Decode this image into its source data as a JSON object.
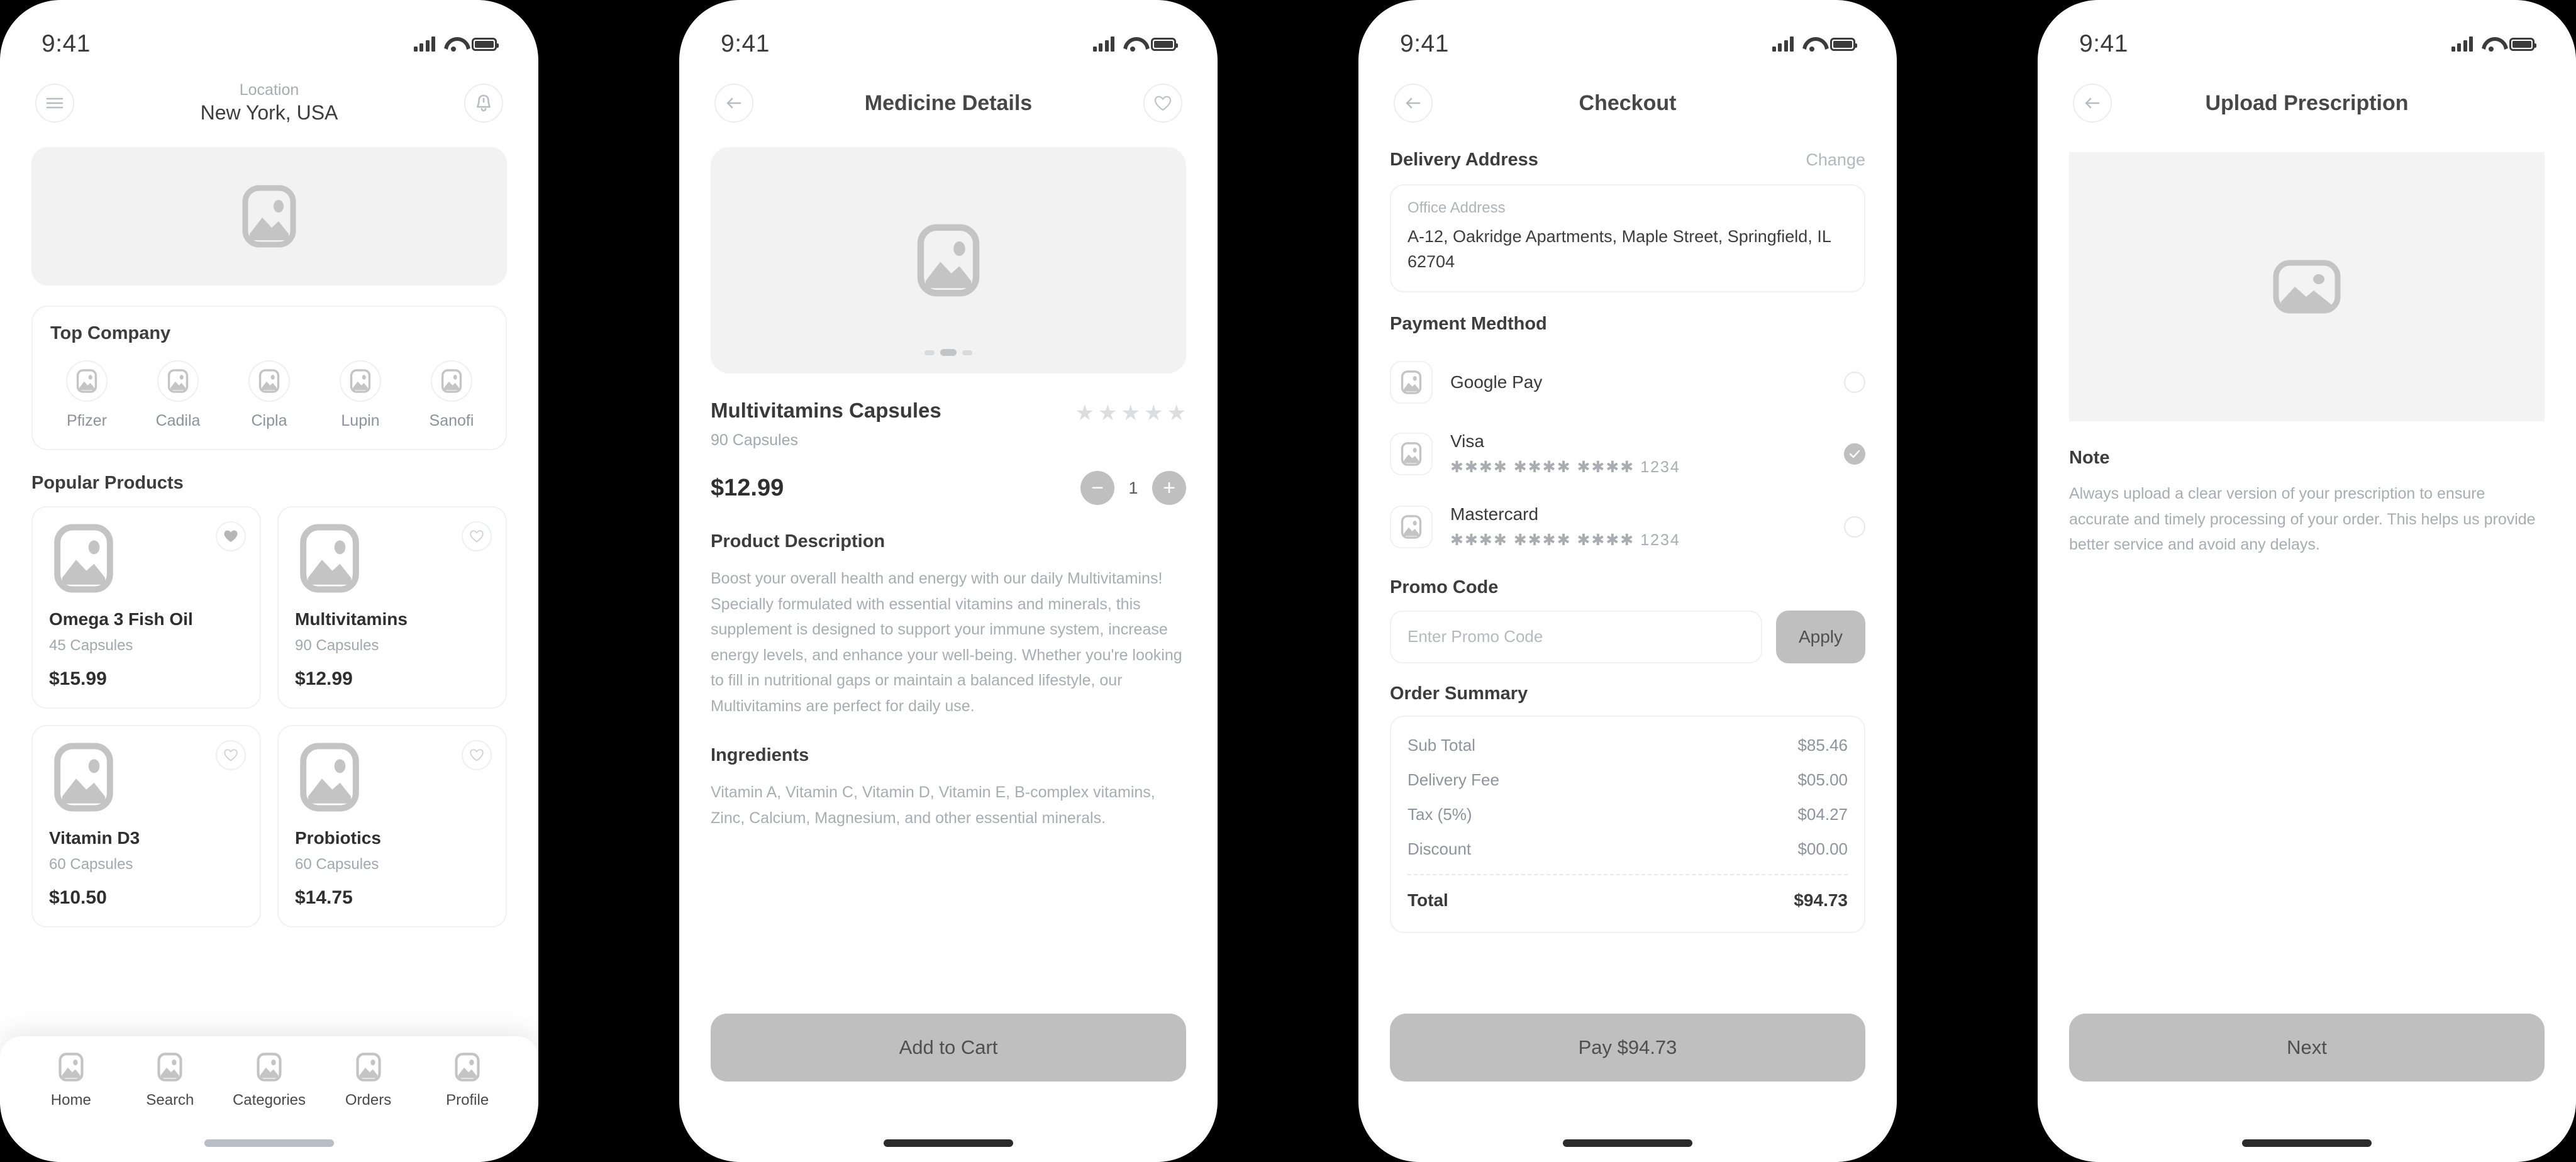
{
  "status_bar": {
    "time": "9:41",
    "signal_icon": "cellular-signal-icon",
    "wifi_icon": "wifi-icon",
    "battery_icon": "battery-icon"
  },
  "screen_home": {
    "menu_icon": "hamburger-menu-icon",
    "bell_icon": "notification-bell-icon",
    "location_label": "Location",
    "location_value": "New York, USA",
    "hero_image": "banner-image-placeholder",
    "top_company": {
      "title": "Top Company",
      "brands": [
        {
          "label": "Pfizer"
        },
        {
          "label": "Cadila"
        },
        {
          "label": "Cipla"
        },
        {
          "label": "Lupin"
        },
        {
          "label": "Sanofi"
        }
      ]
    },
    "popular": {
      "title": "Popular Products",
      "products": [
        {
          "name": "Omega 3 Fish Oil",
          "qty": "45 Capsules",
          "price": "$15.99",
          "favorited": true
        },
        {
          "name": "Multivitamins",
          "qty": "90 Capsules",
          "price": "$12.99",
          "favorited": false
        },
        {
          "name": "Vitamin D3",
          "qty": "60 Capsules",
          "price": "$10.50",
          "favorited": false
        },
        {
          "name": "Probiotics",
          "qty": "60 Capsules",
          "price": "$14.75",
          "favorited": false
        }
      ]
    },
    "tabs": [
      {
        "label": "Home"
      },
      {
        "label": "Search"
      },
      {
        "label": "Categories"
      },
      {
        "label": "Orders"
      },
      {
        "label": "Profile"
      }
    ]
  },
  "screen_details": {
    "back_icon": "back-arrow-icon",
    "favorite_icon": "heart-outline-icon",
    "title": "Medicine Details",
    "carousel_dots": 3,
    "carousel_active": 2,
    "product_name": "Multivitamins Capsules",
    "product_qty": "90 Capsules",
    "rating_stars": 5,
    "price": "$12.99",
    "quantity": "1",
    "minus_label": "−",
    "plus_label": "+",
    "description_title": "Product Description",
    "description": "Boost your overall health and energy with our daily Multivitamins! Specially formulated with essential vitamins and minerals, this supplement is designed to support your immune system, increase energy levels, and enhance your well-being. Whether you're looking to fill in nutritional gaps or maintain a balanced lifestyle, our Multivitamins are perfect for daily use.",
    "ingredients_title": "Ingredients",
    "ingredients": "Vitamin A, Vitamin C, Vitamin D, Vitamin E, B-complex vitamins, Zinc, Calcium, Magnesium, and other essential minerals.",
    "cta": "Add to Cart"
  },
  "screen_checkout": {
    "back_icon": "back-arrow-icon",
    "title": "Checkout",
    "address_label": "Delivery Address",
    "address_change": "Change",
    "address_kind": "Office Address",
    "address_text": "A-12, Oakridge Apartments, Maple Street, Springfield, IL 62704",
    "payment_label": "Payment Medthod",
    "payment_methods": [
      {
        "name": "Google Pay",
        "mask": "",
        "selected": false
      },
      {
        "name": "Visa",
        "mask": "✱✱✱✱ ✱✱✱✱ ✱✱✱✱ 1234",
        "selected": true
      },
      {
        "name": "Mastercard",
        "mask": "✱✱✱✱ ✱✱✱✱ ✱✱✱✱ 1234",
        "selected": false
      }
    ],
    "promo_label": "Promo Code",
    "promo_placeholder": "Enter Promo Code",
    "promo_apply": "Apply",
    "summary_label": "Order Summary",
    "summary_rows": [
      {
        "label": "Sub Total",
        "value": "$85.46"
      },
      {
        "label": "Delivery Fee",
        "value": "$05.00"
      },
      {
        "label": "Tax (5%)",
        "value": "$04.27"
      },
      {
        "label": "Discount",
        "value": "$00.00"
      }
    ],
    "summary_total": {
      "label": "Total",
      "value": "$94.73"
    },
    "cta": "Pay $94.73"
  },
  "screen_upload": {
    "back_icon": "back-arrow-icon",
    "title": "Upload Prescription",
    "upload_image": "prescription-image-placeholder",
    "note_title": "Note",
    "note": "Always upload a clear version of your prescription to ensure accurate and timely processing of your order. This helps us provide better service and avoid any delays.",
    "cta": "Next"
  },
  "colors": {
    "background": "#000000",
    "surface": "#ffffff",
    "muted": "#a9adb2",
    "placeholder": "#f3f3f4",
    "button": "#bfbfbf"
  }
}
